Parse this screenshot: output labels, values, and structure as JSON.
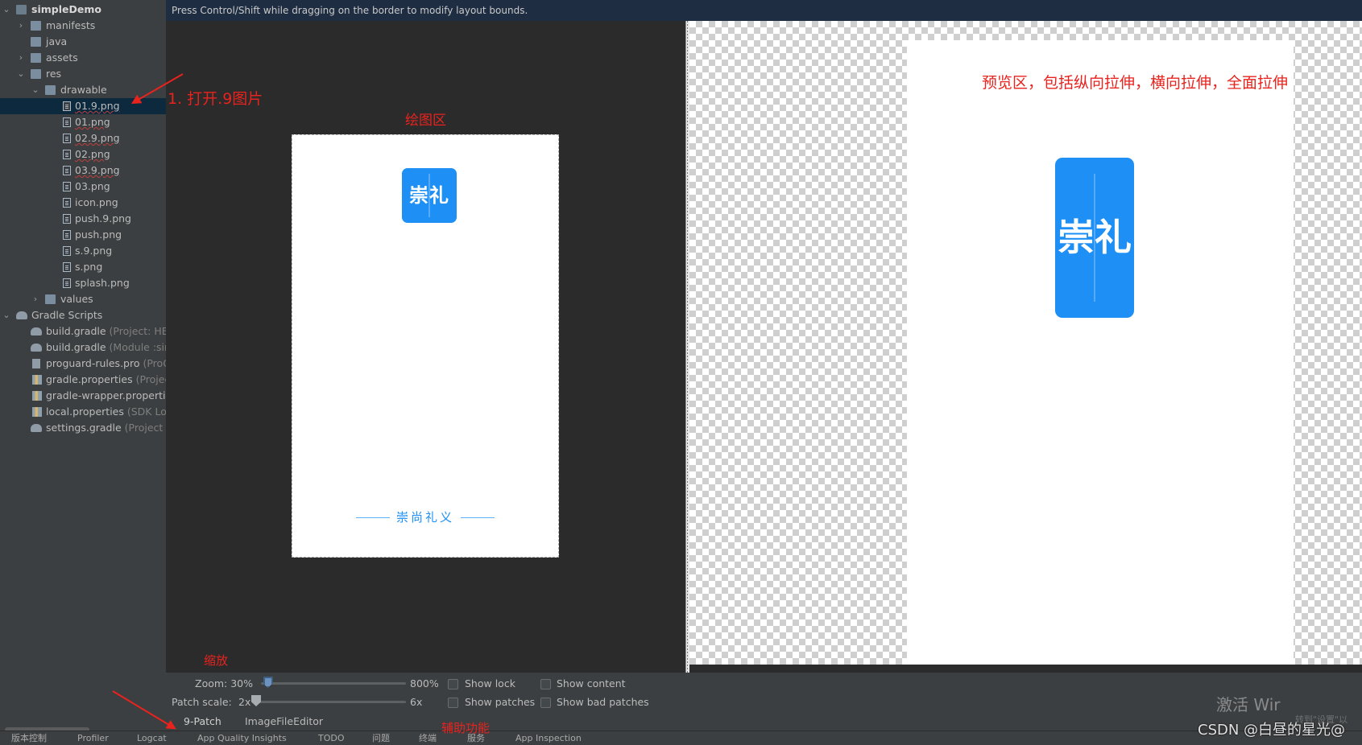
{
  "sidebar": {
    "root": {
      "label": "simpleDemo"
    },
    "items": [
      {
        "label": "manifests"
      },
      {
        "label": "java"
      },
      {
        "label": "assets"
      },
      {
        "label": "res"
      },
      {
        "label": "drawable"
      },
      {
        "label": "01.9.png"
      },
      {
        "label": "01.png"
      },
      {
        "label": "02.9.png"
      },
      {
        "label": "02.png"
      },
      {
        "label": "03.9.png"
      },
      {
        "label": "03.png"
      },
      {
        "label": "icon.png"
      },
      {
        "label": "push.9.png"
      },
      {
        "label": "push.png"
      },
      {
        "label": "s.9.png"
      },
      {
        "label": "s.png"
      },
      {
        "label": "splash.png"
      },
      {
        "label": "values"
      },
      {
        "label": "Gradle Scripts"
      }
    ],
    "gradle": [
      {
        "label": "build.gradle",
        "hint": "(Project: HBu"
      },
      {
        "label": "build.gradle",
        "hint": "(Module :sim"
      },
      {
        "label": "proguard-rules.pro",
        "hint": "(ProG"
      },
      {
        "label": "gradle.properties",
        "hint": "(Project"
      },
      {
        "label": "gradle-wrapper.propertie",
        "hint": ""
      },
      {
        "label": "local.properties",
        "hint": "(SDK Loc"
      },
      {
        "label": "settings.gradle",
        "hint": "(Project Se"
      }
    ]
  },
  "editor": {
    "hint_bar": "Press Control/Shift while dragging on the border to modify layout bounds.",
    "image": {
      "logo_text": "崇礼",
      "slogan": "崇尚礼义"
    }
  },
  "controls": {
    "zoom_label": "Zoom: 30%",
    "zoom_max": "800%",
    "zoom_value": 0.3,
    "patch_scale_label": "Patch scale:",
    "patch_scale_min": "2x",
    "patch_scale_max": "6x",
    "patch_scale_value": 2,
    "checkboxes": {
      "show_lock": "Show lock",
      "show_content": "Show content",
      "show_patches": "Show patches",
      "show_bad_patches": "Show bad patches"
    },
    "tabs": {
      "nine_patch": "9-Patch",
      "image_editor": "ImageFileEditor"
    }
  },
  "annotations": {
    "open": "1. 打开.9图片",
    "draw_area": "绘图区",
    "preview": "预览区，包括纵向拉伸，横向拉伸，全面拉伸",
    "zoom": "缩放",
    "assist": "辅助功能",
    "color": "#e8231e"
  },
  "statusbar": {
    "items": [
      "版本控制",
      "Profiler",
      "Logcat",
      "App Quality Insights",
      "TODO",
      "问题",
      "终端",
      "服务",
      "App Inspection"
    ]
  },
  "watermark": {
    "activate": "激活 Wir",
    "activate_sub": "转到\"设置\"以",
    "csdn": "CSDN @白昼的星光@"
  },
  "colors": {
    "accent": "#1d8ff5",
    "sidebar_bg": "#3c3f41",
    "editor_bg": "#2b2b2b",
    "selection": "#0d293e"
  }
}
